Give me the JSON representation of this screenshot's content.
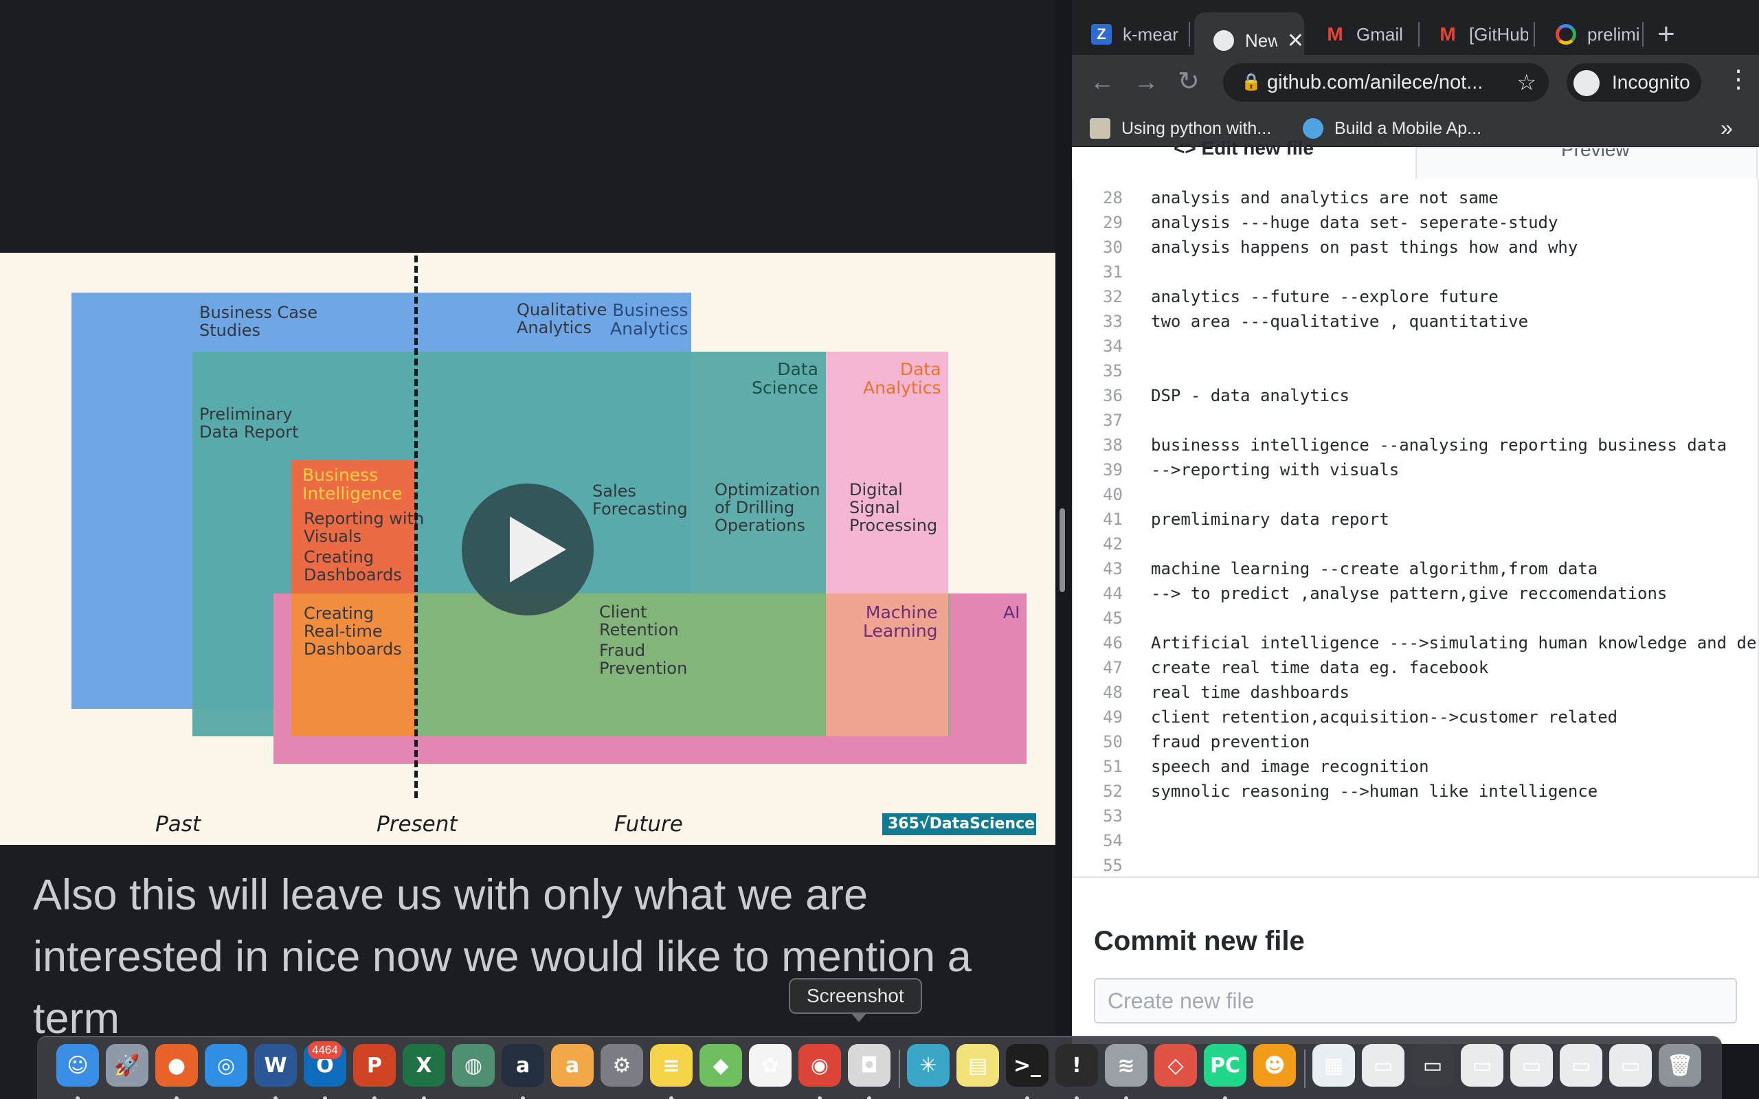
{
  "video": {
    "slide": {
      "regions": {
        "business_analytics": "Business\nAnalytics",
        "data_science": "Data\nScience",
        "data_analytics": "Data\nAnalytics",
        "business_intelligence": "Business\nIntelligence",
        "machine_learning": "Machine\nLearning",
        "ai": "AI"
      },
      "labels": {
        "business_case_studies": "Business Case\nStudies",
        "qualitative_analytics": "Qualitative\nAnalytics",
        "preliminary_data_report": "Preliminary\nData Report",
        "reporting_with_visuals": "Reporting with\nVisuals",
        "creating_dashboards": "Creating\nDashboards",
        "creating_realtime_dashboards": "Creating\nReal-time\nDashboards",
        "sales_forecasting": "Sales\nForecasting",
        "optimization_drilling": "Optimization\nof Drilling\nOperations",
        "digital_signal_processing": "Digital\nSignal\nProcessing",
        "client_retention": "Client\nRetention",
        "fraud_prevention": "Fraud\nPrevention"
      },
      "timeline": {
        "past": "Past",
        "present": "Present",
        "future": "Future"
      },
      "logo": "365√DataScience"
    },
    "caption": "Also this will leave us with only what we are interested in nice now we would like to mention a term"
  },
  "browser": {
    "tabs": [
      {
        "title": "k-mear",
        "icon": "z-icon"
      },
      {
        "title": "New",
        "icon": "github-icon",
        "active": true
      },
      {
        "title": "Gmail -",
        "icon": "gmail-icon"
      },
      {
        "title": "[GitHub",
        "icon": "gmail-icon"
      },
      {
        "title": "prelimi",
        "icon": "google-icon"
      }
    ],
    "new_tab": "+",
    "url": "github.com/anilece/not...",
    "incognito_label": "Incognito",
    "bookmarks": [
      {
        "label": "Using python with..."
      },
      {
        "label": "Build a Mobile Ap..."
      }
    ],
    "bookmarks_overflow": "»",
    "editor_tabs": {
      "edit": "<> Edit new file",
      "preview": "Preview"
    },
    "code_lines": [
      {
        "n": "28",
        "text": "analysis and analytics are not same"
      },
      {
        "n": "29",
        "text": "analysis ---huge data set- seperate-study"
      },
      {
        "n": "30",
        "text": "analysis happens on past things how and why"
      },
      {
        "n": "31",
        "text": ""
      },
      {
        "n": "32",
        "text": "analytics --future --explore future"
      },
      {
        "n": "33",
        "text": "two area ---qualitative , quantitative"
      },
      {
        "n": "34",
        "text": ""
      },
      {
        "n": "35",
        "text": ""
      },
      {
        "n": "36",
        "text": "DSP - data analytics"
      },
      {
        "n": "37",
        "text": ""
      },
      {
        "n": "38",
        "text": "businesss intelligence --analysing reporting business data"
      },
      {
        "n": "39",
        "text": "-->reporting with visuals"
      },
      {
        "n": "40",
        "text": ""
      },
      {
        "n": "41",
        "text": "premliminary data report"
      },
      {
        "n": "42",
        "text": ""
      },
      {
        "n": "43",
        "text": "machine learning --create algorithm,from data"
      },
      {
        "n": "44",
        "text": "--> to predict ,analyse pattern,give reccomendations"
      },
      {
        "n": "45",
        "text": ""
      },
      {
        "n": "46",
        "text": "Artificial intelligence --->simulating human knowledge and de"
      },
      {
        "n": "47",
        "text": "create real time data eg. facebook"
      },
      {
        "n": "48",
        "text": "real time dashboards"
      },
      {
        "n": "49",
        "text": "client retention,acquisition-->customer related"
      },
      {
        "n": "50",
        "text": "fraud prevention"
      },
      {
        "n": "51",
        "text": "speech and image recognition"
      },
      {
        "n": "52",
        "text": "symnolic reasoning -->human like intelligence"
      },
      {
        "n": "53",
        "text": ""
      },
      {
        "n": "54",
        "text": ""
      },
      {
        "n": "55",
        "text": ""
      }
    ],
    "commit": {
      "title": "Commit new file",
      "placeholder": "Create new file"
    }
  },
  "dock": {
    "tooltip": "Screenshot",
    "outlook_badge": "4464",
    "items": [
      {
        "name": "finder-icon",
        "color": "#3a8ee6",
        "glyph": "☺"
      },
      {
        "name": "launchpad-icon",
        "color": "#8e9aa8",
        "glyph": "🚀"
      },
      {
        "name": "firefox-icon",
        "color": "#e8622a",
        "glyph": "●"
      },
      {
        "name": "safari-icon",
        "color": "#2f8fe4",
        "glyph": "◎"
      },
      {
        "name": "word-icon",
        "color": "#2b5797",
        "glyph": "W"
      },
      {
        "name": "outlook-icon",
        "color": "#0f6cbd",
        "glyph": "O"
      },
      {
        "name": "powerpoint-icon",
        "color": "#d04423",
        "glyph": "P"
      },
      {
        "name": "excel-icon",
        "color": "#1f7244",
        "glyph": "X"
      },
      {
        "name": "globe-icon",
        "color": "#4f8f72",
        "glyph": "◍"
      },
      {
        "name": "amazon-icon",
        "color": "#232f3e",
        "glyph": "a"
      },
      {
        "name": "amazon-assistant-icon",
        "color": "#f3a847",
        "glyph": "a"
      },
      {
        "name": "system-preferences-icon",
        "color": "#7a7e84",
        "glyph": "⚙"
      },
      {
        "name": "notes-icon",
        "color": "#f6d44a",
        "glyph": "≡"
      },
      {
        "name": "maps-icon",
        "color": "#6fbf5f",
        "glyph": "◆"
      },
      {
        "name": "photos-icon",
        "color": "#f4f4f4",
        "glyph": "✿"
      },
      {
        "name": "chrome-icon",
        "color": "#db4437",
        "glyph": "◉"
      },
      {
        "name": "screenshot-icon",
        "color": "#d8d8d8",
        "glyph": "◘"
      },
      {
        "name": "sparkle-icon",
        "color": "#3aa6c8",
        "glyph": "✳"
      },
      {
        "name": "stickies-icon",
        "color": "#f2e27a",
        "glyph": "▤"
      },
      {
        "name": "terminal-icon",
        "color": "#1e1e1e",
        "glyph": ">_"
      },
      {
        "name": "console-icon",
        "color": "#2b2b2b",
        "glyph": "!"
      },
      {
        "name": "database-icon",
        "color": "#9aa0a6",
        "glyph": "≋"
      },
      {
        "name": "git-client-icon",
        "color": "#e05243",
        "glyph": "◇"
      },
      {
        "name": "pycharm-icon",
        "color": "#21d789",
        "glyph": "PC"
      },
      {
        "name": "character-icon",
        "color": "#f39c1a",
        "glyph": "☻"
      },
      {
        "name": "archive-icon",
        "color": "#e9eef2",
        "glyph": "▦"
      },
      {
        "name": "window-thumbnail-1",
        "color": "#e9ecef",
        "glyph": "▭"
      },
      {
        "name": "window-thumbnail-2",
        "color": "#3a3d42",
        "glyph": "▭"
      },
      {
        "name": "window-thumbnail-3",
        "color": "#e9ecef",
        "glyph": "▭"
      },
      {
        "name": "window-thumbnail-4",
        "color": "#e9ecef",
        "glyph": "▭"
      },
      {
        "name": "window-thumbnail-5",
        "color": "#e9ecef",
        "glyph": "▭"
      },
      {
        "name": "window-thumbnail-6",
        "color": "#e9ecef",
        "glyph": "▭"
      },
      {
        "name": "trash-icon",
        "color": "#8e9399",
        "glyph": "🗑"
      }
    ]
  }
}
